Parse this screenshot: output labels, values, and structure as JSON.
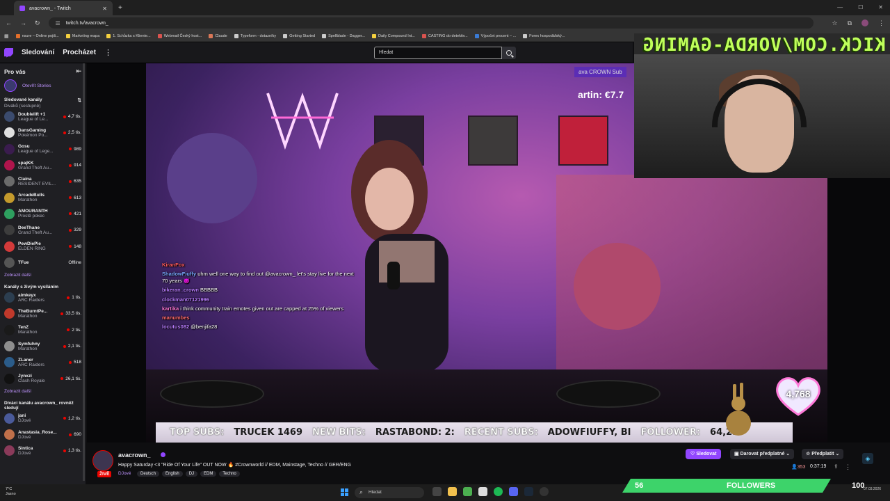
{
  "browser": {
    "tab_title": "avacrown_ - Twitch",
    "url": "twitch.tv/avacrown_",
    "bookmarks": [
      {
        "label": "nsure – Online pojiš...",
        "color": "#e46f2a"
      },
      {
        "label": "Marketing mapa",
        "color": "#f4d03f"
      },
      {
        "label": "1. Schůzka s Kliente...",
        "color": "#f4d03f"
      },
      {
        "label": "Webmail Český host...",
        "color": "#d9534f"
      },
      {
        "label": "Claude",
        "color": "#d97757"
      },
      {
        "label": "Typeform - dotazníky",
        "color": "#cccccc"
      },
      {
        "label": "Getting Started",
        "color": "#cccccc"
      },
      {
        "label": "Spellblade - Dagger...",
        "color": "#cccccc"
      },
      {
        "label": "Daily Compound Int...",
        "color": "#f4d03f"
      },
      {
        "label": "CASTING do detektiv...",
        "color": "#d9534f"
      },
      {
        "label": "Výpočet procent – ...",
        "color": "#3a7bd5"
      },
      {
        "label": "Forex hospodářský...",
        "color": "#cccccc"
      }
    ]
  },
  "nav": {
    "following": "Sledování",
    "browse": "Procházet",
    "search_placeholder": "Hledat"
  },
  "sidebar": {
    "header": "Pro vás",
    "stories": "Otevřít Stories",
    "followed_title": "Sledované kanály",
    "followed_sort": "Diváků (sestupně)",
    "followed": [
      {
        "name": "Doublelift +1",
        "game": "League of Le...",
        "viewers": "4,7 tis.",
        "color": "#3b4b6e"
      },
      {
        "name": "DansGaming",
        "game": "Pokémon Po...",
        "viewers": "2,5 tis.",
        "color": "#e0e0e0"
      },
      {
        "name": "Gosu",
        "game": "League of Lege...",
        "viewers": "989",
        "color": "#3a1c4e"
      },
      {
        "name": "spajKK",
        "game": "Grand Theft Au...",
        "viewers": "914",
        "color": "#b0154c"
      },
      {
        "name": "Claina",
        "game": "RESIDENT EVIL...",
        "viewers": "635",
        "color": "#6b6b6b"
      },
      {
        "name": "ArcadeBulls",
        "game": "Marathon",
        "viewers": "613",
        "color": "#c49a2c"
      },
      {
        "name": "AMOURANTH",
        "game": "Prostě pokec",
        "viewers": "421",
        "color": "#2e9f5f"
      },
      {
        "name": "DeeThane",
        "game": "Grand Theft Au...",
        "viewers": "329",
        "color": "#3d3d3d"
      },
      {
        "name": "PewDiePie",
        "game": "ELDEN RING",
        "viewers": "148",
        "color": "#d33a3a"
      },
      {
        "name": "TFue",
        "game": "",
        "viewers": "Offline",
        "color": "#555555"
      }
    ],
    "show_more": "Zobrazit další",
    "live_title": "Kanály s živým vysíláním",
    "live": [
      {
        "name": "aimkeyx",
        "game": "ARC Raiders",
        "viewers": "1 tis.",
        "color": "#2c3e50"
      },
      {
        "name": "TheBurntPe...",
        "game": "Marathon",
        "viewers": "33,5 tis.",
        "color": "#c0392b"
      },
      {
        "name": "TenZ",
        "game": "Marathon",
        "viewers": "2 tis.",
        "color": "#1a1a1a"
      },
      {
        "name": "Symfuhny",
        "game": "Marathon",
        "viewers": "2,1 tis.",
        "color": "#8e8e8e"
      },
      {
        "name": "ZLaner",
        "game": "ARC Raiders",
        "viewers": "518",
        "color": "#2b5c8a"
      },
      {
        "name": "Jynxzi",
        "game": "Clash Royale",
        "viewers": "26,1 tis.",
        "color": "#111111"
      }
    ],
    "show_more_2": "Zobrazit další",
    "similar_title": "Diváci kanálu avacrown_ rovněž sledují",
    "similar": [
      {
        "name": "jani",
        "game": "DJové",
        "viewers": "1,2 tis.",
        "color": "#4a5a9a"
      },
      {
        "name": "Anastasia_Rose...",
        "game": "DJové",
        "viewers": "690",
        "color": "#c0704a"
      },
      {
        "name": "Sintica",
        "game": "DJové",
        "viewers": "1,3 tis.",
        "color": "#8a3a5a"
      }
    ]
  },
  "overlay": {
    "kick_text": "KICK.COM/VORDA-GAMING",
    "sub_tag": "ava CROWN Sub",
    "tip_text": "artin: €7.7",
    "heart_count": "4,768",
    "ticker": {
      "top_subs_label": "TOP SUBS:",
      "top_subs_value": "TRUCEK 1469",
      "new_bits_label": "NEW BITS:",
      "new_bits_value": "RASTABOND: 2:",
      "recent_subs_label": "RECENT SUBS:",
      "recent_subs_value": "ADOWFIUFFY,  BI",
      "follower_label": "FOLLOWER:",
      "follower_value": "64,217"
    },
    "chat": [
      {
        "user": "KiranFox",
        "text": "",
        "color": "#ff5b5b"
      },
      {
        "user": "ShadowFiuffy",
        "text": "uhm well one way to find out @avacrown_ let's stay live for the next 70 years 😈",
        "color": "#7aa7ff"
      },
      {
        "user": "bikeran_crown",
        "text": "BBBBB",
        "color": "#b97cff"
      },
      {
        "user": "clockman07121996",
        "text": "",
        "color": "#b97cff"
      },
      {
        "user": "kartika",
        "text": "i think community train emotes given out are capped at 25% of viewers",
        "color": "#ff7ad9"
      },
      {
        "user": "manumbes",
        "text": "",
        "color": "#ff6b6b"
      },
      {
        "user": "locutus082",
        "text": "@benjifa28",
        "color": "#b97cff"
      }
    ]
  },
  "stream": {
    "streamer": "avacrown_",
    "live_badge": "ŽIVĚ",
    "title": "Happy Saturday <3 \"Ride Of Your Life\" OUT NOW 🔥 #Crownworld // EDM, Mainstage, Techno // GER/ENG",
    "category": "DJové",
    "tags": [
      "Deutsch",
      "English",
      "DJ",
      "EDM",
      "Techno"
    ],
    "follow_label": "Sledovat",
    "gift_label": "Darovat předplatné",
    "subscribe_label": "Předplatit",
    "viewers": "353",
    "uptime": "0:37:19"
  },
  "taskbar": {
    "weather_temp": "7°C",
    "weather_desc": "Jasno",
    "search_placeholder": "Hledat",
    "follow_goal_current": "56",
    "follow_goal_label": "FOLLOWERS",
    "follow_goal_target": "100",
    "follow_goal_progress": 0.56,
    "date": "07.03.2026"
  },
  "colors": {
    "twitch_purple": "#9146ff",
    "live_red": "#eb0400",
    "kick_green": "#bfff5a",
    "goal_green": "#3dd36a"
  }
}
